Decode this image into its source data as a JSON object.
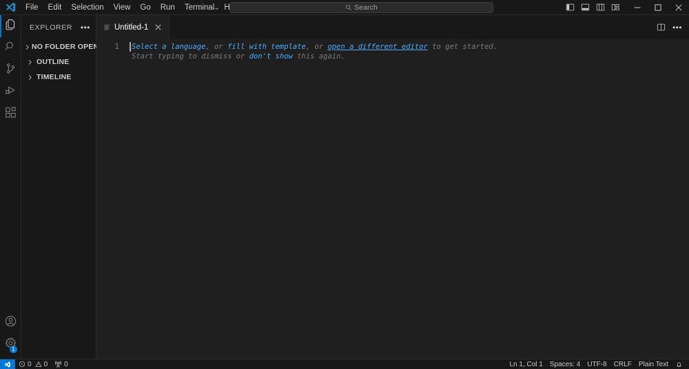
{
  "titlebar": {
    "logo_icon": "vscode-logo-icon",
    "menus": [
      {
        "label": "File"
      },
      {
        "label": "Edit"
      },
      {
        "label": "Selection"
      },
      {
        "label": "View"
      },
      {
        "label": "Go"
      },
      {
        "label": "Run"
      },
      {
        "label": "Terminal"
      },
      {
        "label": "Help"
      }
    ],
    "nav": {
      "back_icon": "arrow-left-icon",
      "back_glyph": "←",
      "forward_icon": "arrow-right-icon",
      "forward_glyph": "→"
    },
    "search": {
      "icon": "search-icon",
      "label": "Search",
      "placeholder": "Search"
    },
    "layout_buttons": [
      {
        "name": "toggle-primary-sidebar-button",
        "title": "Toggle Primary Side Bar"
      },
      {
        "name": "toggle-panel-button",
        "title": "Toggle Panel"
      },
      {
        "name": "toggle-secondary-sidebar-button",
        "title": "Toggle Secondary Side Bar"
      },
      {
        "name": "customize-layout-button",
        "title": "Customize Layout"
      }
    ],
    "window_buttons": {
      "minimize_glyph": "─",
      "maximize_glyph": "☐",
      "close_glyph": "✕"
    }
  },
  "activitybar": {
    "top_items": [
      {
        "name": "activity-explorer",
        "icon": "files-icon",
        "label": "Explorer",
        "active": true,
        "badge": ""
      },
      {
        "name": "activity-search",
        "icon": "search-icon",
        "label": "Search",
        "active": false,
        "badge": ""
      },
      {
        "name": "activity-source-control",
        "icon": "source-control-icon",
        "label": "Source Control",
        "active": false,
        "badge": ""
      },
      {
        "name": "activity-run-debug",
        "icon": "run-and-debug-icon",
        "label": "Run and Debug",
        "active": false,
        "badge": ""
      },
      {
        "name": "activity-extensions",
        "icon": "extensions-icon",
        "label": "Extensions",
        "active": false,
        "badge": ""
      }
    ],
    "bottom_items": [
      {
        "name": "activity-accounts",
        "icon": "account-icon",
        "label": "Accounts",
        "badge": ""
      },
      {
        "name": "activity-manage",
        "icon": "gear-icon",
        "label": "Manage",
        "badge": "1"
      }
    ]
  },
  "sidebar": {
    "title": "EXPLORER",
    "more_actions_icon": "ellipsis-icon",
    "more_actions_glyph": "•••",
    "sections": [
      {
        "label": "NO FOLDER OPENED",
        "collapsed": true
      },
      {
        "label": "OUTLINE",
        "collapsed": true
      },
      {
        "label": "TIMELINE",
        "collapsed": true
      }
    ]
  },
  "editor": {
    "tabs": [
      {
        "label": "Untitled-1",
        "icon": "file-text-icon",
        "close_icon": "close-icon",
        "close_glyph": "✕",
        "active": true,
        "dirty": false
      }
    ],
    "actions": [
      {
        "name": "split-editor-right-button",
        "icon": "split-editor-icon"
      },
      {
        "name": "editor-more-actions-button",
        "icon": "ellipsis-icon",
        "glyph": "•••"
      }
    ],
    "line_numbers": [
      "1"
    ],
    "placeholder": {
      "line1": [
        {
          "text": "Select a language",
          "link": true,
          "underline": false
        },
        {
          "text": ", or ",
          "link": false
        },
        {
          "text": "fill with template",
          "link": true,
          "underline": false
        },
        {
          "text": ", or ",
          "link": false
        },
        {
          "text": "open a different editor",
          "link": true,
          "underline": true
        },
        {
          "text": " to get started.",
          "link": false
        }
      ],
      "line2": [
        {
          "text": "Start typing to dismiss or ",
          "link": false
        },
        {
          "text": "don't show",
          "link": true,
          "underline": false
        },
        {
          "text": " this again.",
          "link": false
        }
      ]
    }
  },
  "statusbar": {
    "remote": {
      "icon": "remote-window-icon",
      "label": ""
    },
    "left_items": [
      {
        "name": "status-problems",
        "icon": "error-icon",
        "errors": "0",
        "warnings": "0",
        "warning_icon": "warning-icon"
      },
      {
        "name": "status-ports",
        "icon": "radio-tower-icon",
        "label": "0"
      }
    ],
    "right_items": [
      {
        "name": "status-cursor-position",
        "label": "Ln 1, Col 1"
      },
      {
        "name": "status-indentation",
        "label": "Spaces: 4"
      },
      {
        "name": "status-encoding",
        "label": "UTF-8"
      },
      {
        "name": "status-eol",
        "label": "CRLF"
      },
      {
        "name": "status-language-mode",
        "label": "Plain Text"
      },
      {
        "name": "status-notifications",
        "icon": "bell-icon",
        "label": ""
      }
    ]
  },
  "colors": {
    "accent": "#0078d4",
    "link": "#4daafc",
    "titlebar_bg": "#181818",
    "editor_bg": "#1f1f1f",
    "sidebar_bg": "#181818",
    "text": "#cccccc",
    "muted": "#7a7a7a"
  }
}
